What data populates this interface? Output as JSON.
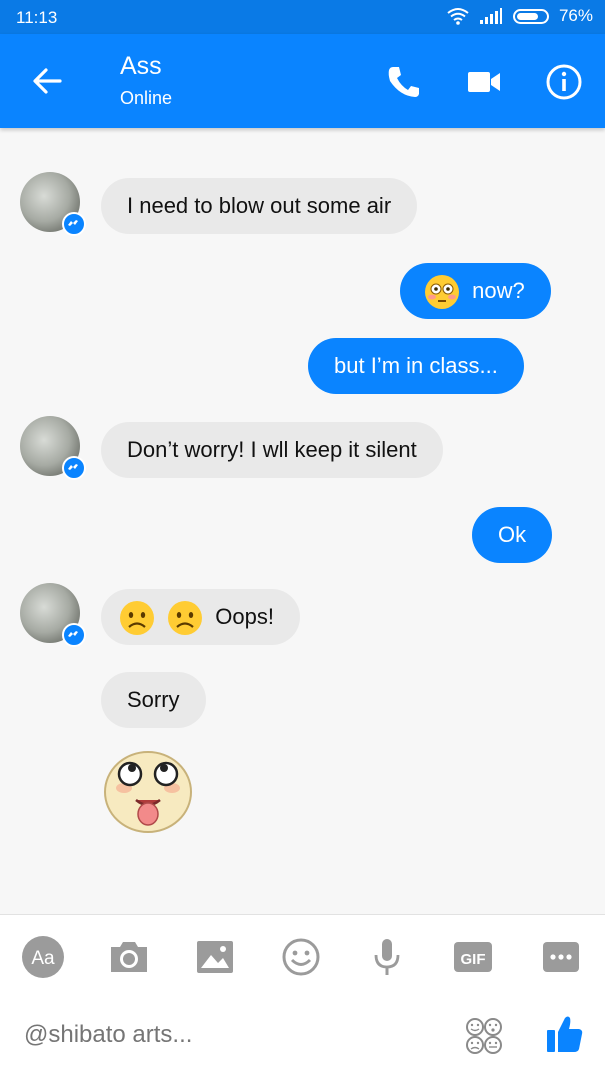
{
  "status": {
    "time": "11:13",
    "battery": "76%",
    "battery_level": 0.76
  },
  "header": {
    "name": "Ass",
    "status": "Online"
  },
  "messages": {
    "m1": "I need to blow out some air",
    "m2": "now?",
    "m3": "but I’m in class...",
    "m4": "Don’t worry! I wll keep it silent",
    "m5": "Ok",
    "m6": "Oops!",
    "m7": "Sorry"
  },
  "composer": {
    "placeholder": "@shibato arts..."
  },
  "icons": {
    "back": "arrow-left-icon",
    "call": "phone-icon",
    "video": "video-camera-icon",
    "info": "info-icon",
    "text": "aa-icon",
    "camera": "camera-icon",
    "gallery": "image-icon",
    "emoji": "smiley-icon",
    "mic": "microphone-icon",
    "gif": "gif-icon",
    "more": "more-icon",
    "stickers": "stickers-icon",
    "like": "thumbs-up-icon"
  },
  "colors": {
    "accent": "#0a84ff",
    "statusbar": "#0a7ae6",
    "incoming_bubble": "#e9e9e9"
  }
}
